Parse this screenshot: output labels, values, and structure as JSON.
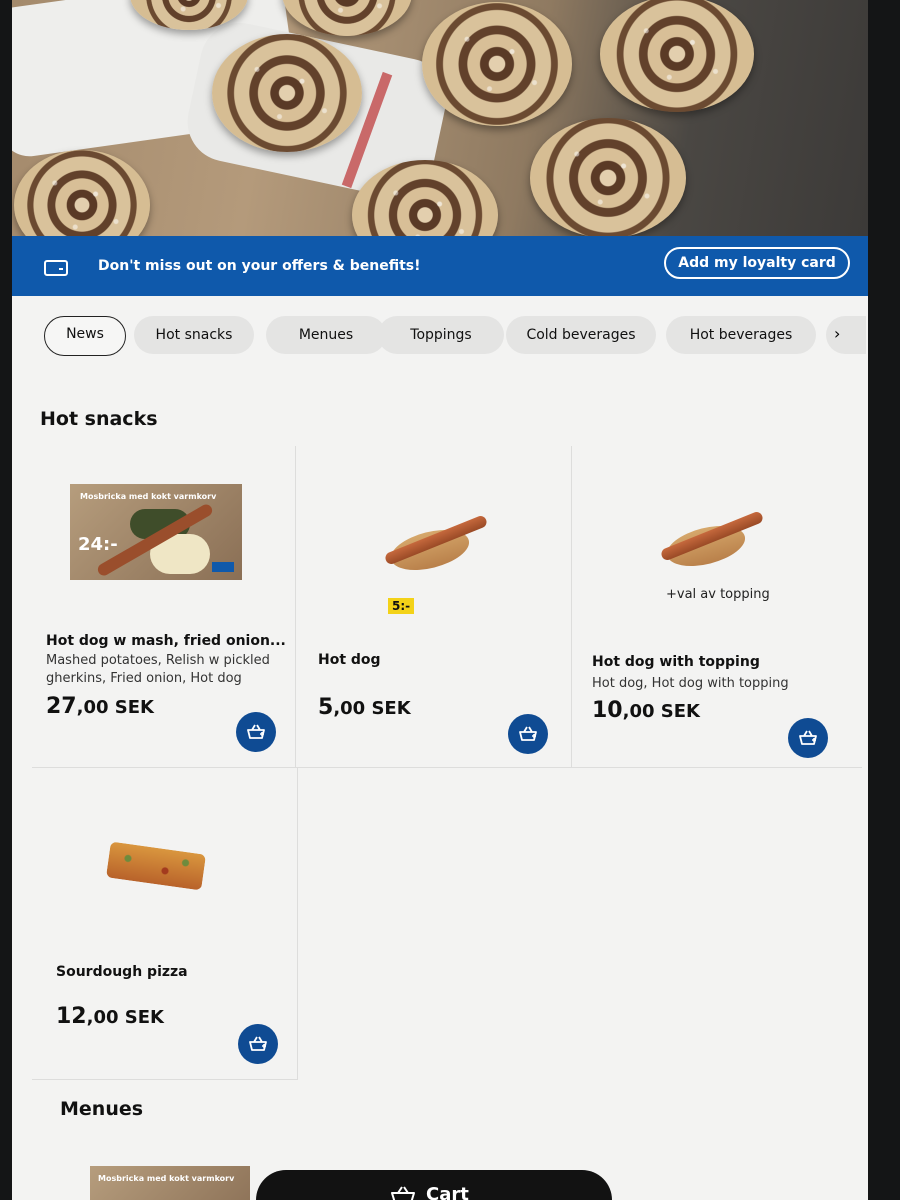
{
  "loyalty": {
    "text": "Don't miss out on your offers & benefits!",
    "button": "Add my loyalty card"
  },
  "tabs": [
    "News",
    "Hot snacks",
    "Menues",
    "Toppings",
    "Cold beverages",
    "Hot beverages"
  ],
  "active_tab": "News",
  "sections": {
    "hot_snacks": "Hot snacks",
    "menues": "Menues"
  },
  "products": [
    {
      "name": "Hot dog w mash, fried onion...",
      "description": "Mashed potatoes, Relish w pickled gherkins, Fried onion, Hot dog",
      "price_main": "27",
      "price_rest": ",00 SEK",
      "image_title": "Mosbricka med kokt varmkorv",
      "image_price": "24:-",
      "icon": "hotdog-mash-photo"
    },
    {
      "name": "Hot dog",
      "description": "",
      "price_main": "5",
      "price_rest": ",00 SEK",
      "tag": "5:-",
      "icon": "hotdog-icon"
    },
    {
      "name": "Hot dog with topping",
      "description": "Hot dog, Hot dog with topping",
      "price_main": "10",
      "price_rest": ",00 SEK",
      "note": "+val av topping",
      "icon": "hotdog-icon"
    },
    {
      "name": "Sourdough pizza",
      "description": "",
      "price_main": "12",
      "price_rest": ",00 SEK",
      "icon": "pizza-icon"
    }
  ],
  "menu_preview": {
    "image_title": "Mosbricka med kokt varmkorv"
  },
  "cart": {
    "label": "Cart"
  },
  "colors": {
    "brand_blue": "#0f59ab",
    "add_button": "#0f4b93",
    "price_tag": "#f3d218",
    "cart_button": "#121212"
  }
}
